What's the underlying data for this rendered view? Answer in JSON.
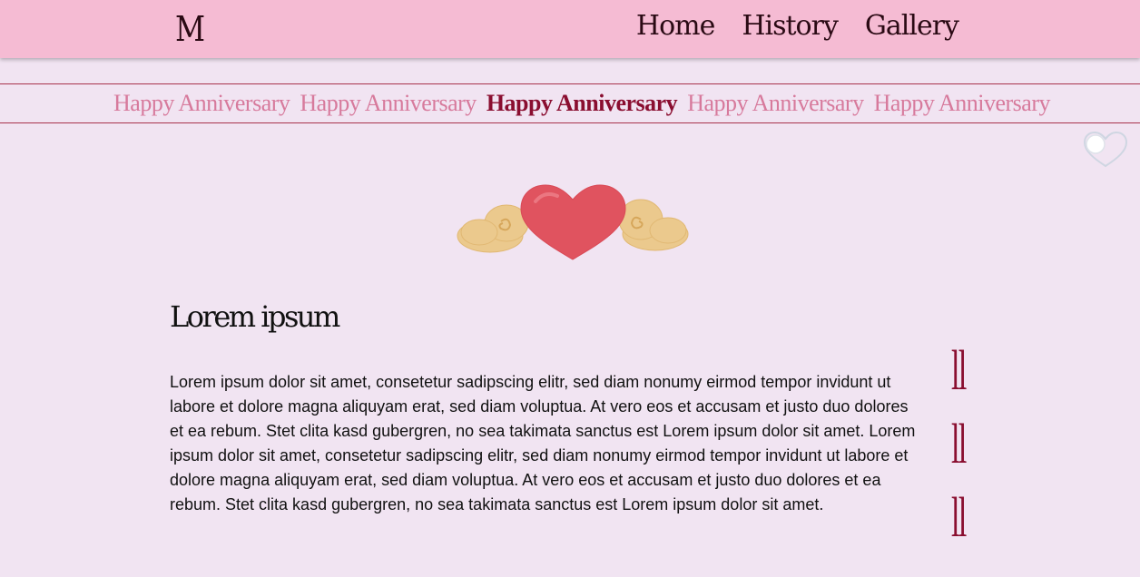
{
  "header": {
    "logo_text": "M",
    "nav": [
      {
        "label": "Home"
      },
      {
        "label": "History"
      },
      {
        "label": "Gallery"
      }
    ]
  },
  "marquee": {
    "items": [
      {
        "text": "Happy Anniversary",
        "highlighted": false
      },
      {
        "text": "Happy Anniversary",
        "highlighted": false
      },
      {
        "text": "Happy Anniversary",
        "highlighted": true
      },
      {
        "text": "Happy Anniversary",
        "highlighted": false
      },
      {
        "text": "Happy Anniversary",
        "highlighted": false
      }
    ]
  },
  "theme_toggle": {
    "state": "off"
  },
  "content": {
    "title": "Lorem ipsum",
    "paragraph": "Lorem ipsum dolor sit amet, consetetur sadipscing elitr, sed diam nonumy eirmod tempor invidunt ut labore et dolore magna aliquyam erat, sed diam voluptua. At vero eos et accusam et justo duo dolores et ea rebum. Stet clita kasd gubergren, no sea takimata sanctus est Lorem ipsum dolor sit amet. Lorem ipsum dolor sit amet, consetetur sadipscing elitr, sed diam nonumy eirmod tempor invidunt ut labore et dolore magna aliquyam erat, sed diam voluptua. At vero eos et accusam et justo duo dolores et ea rebum. Stet clita kasd gubergren, no sea takimata sanctus est Lorem ipsum dolor sit amet."
  },
  "quote_marks": [
    "ll",
    "ll",
    "ll"
  ],
  "colors": {
    "header_bg": "#f5bbd3",
    "page_bg": "#f1e4f2",
    "accent": "#8a0e30",
    "marquee_dim": "#d77a9c"
  },
  "icons": {
    "hero": "winged-heart-icon",
    "toggle": "heart-toggle-icon"
  }
}
